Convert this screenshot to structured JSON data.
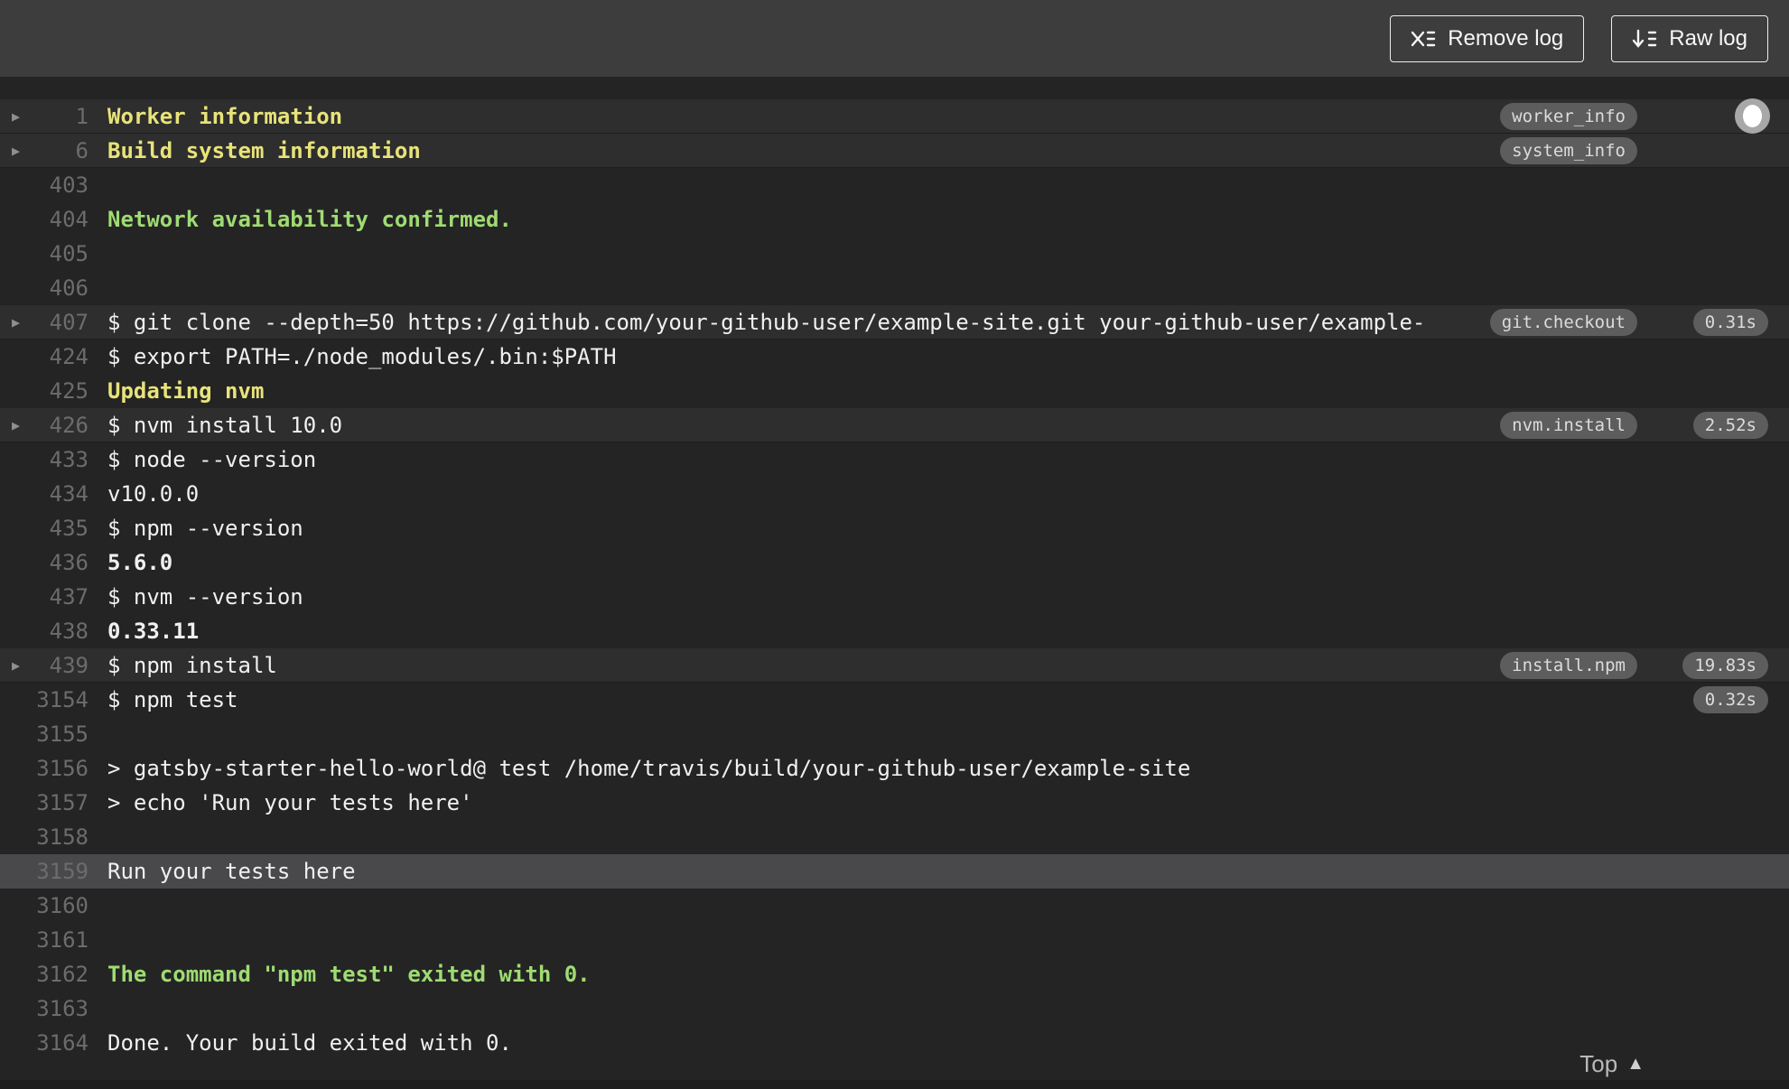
{
  "toolbar": {
    "remove_log_label": "Remove log",
    "raw_log_label": "Raw log",
    "remove_log_icon": "x-with-list-lines",
    "raw_log_icon": "down-arrow-with-list-lines"
  },
  "colors": {
    "header_bg": "#3d3d3d",
    "log_bg": "#242424",
    "row_highlight": "#2e2e2e",
    "selected_row": "#49494b",
    "text": "#f0f0f0",
    "line_number": "#6c6c6c",
    "yellow": "#e8e37a",
    "green": "#9fdb72",
    "badge_bg": "#5d5d5d",
    "badge_text": "#dcdcdc"
  },
  "log": {
    "fold_arrow_icon": "▶",
    "rows": [
      {
        "line": "1",
        "text": "Worker information",
        "style": "yellow",
        "fold": true,
        "highlight": true,
        "badge": "worker_info"
      },
      {
        "line": "6",
        "text": "Build system information",
        "style": "yellow",
        "fold": true,
        "highlight": true,
        "badge": "system_info"
      },
      {
        "line": "403",
        "text": ""
      },
      {
        "line": "404",
        "text": "Network availability confirmed.",
        "style": "green"
      },
      {
        "line": "405",
        "text": ""
      },
      {
        "line": "406",
        "text": ""
      },
      {
        "line": "407",
        "text": "$ git clone --depth=50 https://github.com/your-github-user/example-site.git your-github-user/example-",
        "fold": true,
        "highlight": true,
        "badge": "git.checkout",
        "time": "0.31s"
      },
      {
        "line": "424",
        "text": "$ export PATH=./node_modules/.bin:$PATH"
      },
      {
        "line": "425",
        "text": "Updating nvm",
        "style": "yellow"
      },
      {
        "line": "426",
        "text": "$ nvm install 10.0",
        "fold": true,
        "highlight": true,
        "badge": "nvm.install",
        "time": "2.52s"
      },
      {
        "line": "433",
        "text": "$ node --version"
      },
      {
        "line": "434",
        "text": "v10.0.0"
      },
      {
        "line": "435",
        "text": "$ npm --version"
      },
      {
        "line": "436",
        "text": "5.6.0",
        "style": "bold"
      },
      {
        "line": "437",
        "text": "$ nvm --version"
      },
      {
        "line": "438",
        "text": "0.33.11",
        "style": "bold"
      },
      {
        "line": "439",
        "text": "$ npm install",
        "fold": true,
        "highlight": true,
        "badge": "install.npm",
        "time": "19.83s"
      },
      {
        "line": "3154",
        "text": "$ npm test",
        "time": "0.32s"
      },
      {
        "line": "3155",
        "text": ""
      },
      {
        "line": "3156",
        "text": "> gatsby-starter-hello-world@ test /home/travis/build/your-github-user/example-site"
      },
      {
        "line": "3157",
        "text": "> echo 'Run your tests here'"
      },
      {
        "line": "3158",
        "text": ""
      },
      {
        "line": "3159",
        "text": "Run your tests here",
        "selected": true
      },
      {
        "line": "3160",
        "text": ""
      },
      {
        "line": "3161",
        "text": ""
      },
      {
        "line": "3162",
        "text": "The command \"npm test\" exited with 0.",
        "style": "green"
      },
      {
        "line": "3163",
        "text": ""
      },
      {
        "line": "3164",
        "text": "Done. Your build exited with 0."
      }
    ]
  },
  "footer": {
    "top_label": "Top",
    "top_icon": "▲"
  }
}
